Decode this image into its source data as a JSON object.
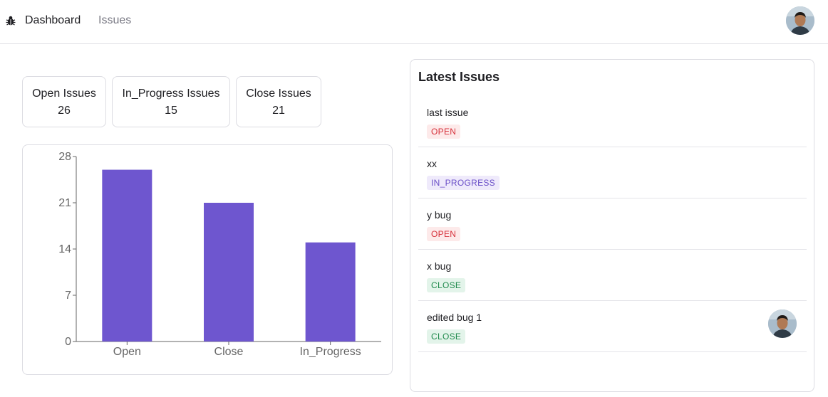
{
  "nav": {
    "logo_icon": "bug-icon",
    "links": [
      "Dashboard",
      "Issues"
    ]
  },
  "stats": [
    {
      "label": "Open Issues",
      "value": "26"
    },
    {
      "label": "In_Progress Issues",
      "value": "15"
    },
    {
      "label": "Close Issues",
      "value": "21"
    }
  ],
  "chart_data": {
    "type": "bar",
    "categories": [
      "Open",
      "Close",
      "In_Progress"
    ],
    "values": [
      26,
      21,
      15
    ],
    "title": "",
    "xlabel": "",
    "ylabel": "",
    "ylim": [
      0,
      28
    ],
    "yticks": [
      "0",
      "7",
      "14",
      "21",
      "28"
    ],
    "color": "#6e56cf",
    "grid": false
  },
  "latest": {
    "title": "Latest Issues",
    "issues": [
      {
        "title": "last issue",
        "status": "OPEN"
      },
      {
        "title": "xx",
        "status": "IN_PROGRESS"
      },
      {
        "title": "y bug",
        "status": "OPEN"
      },
      {
        "title": "x bug",
        "status": "CLOSE"
      },
      {
        "title": "edited bug 1",
        "status": "CLOSE",
        "assignee_avatar": "avatar"
      }
    ]
  },
  "colors": {
    "accent": "#6e56cf",
    "open": "#d6303a",
    "in_progress": "#6b4fc8",
    "close": "#1f8a4c"
  }
}
